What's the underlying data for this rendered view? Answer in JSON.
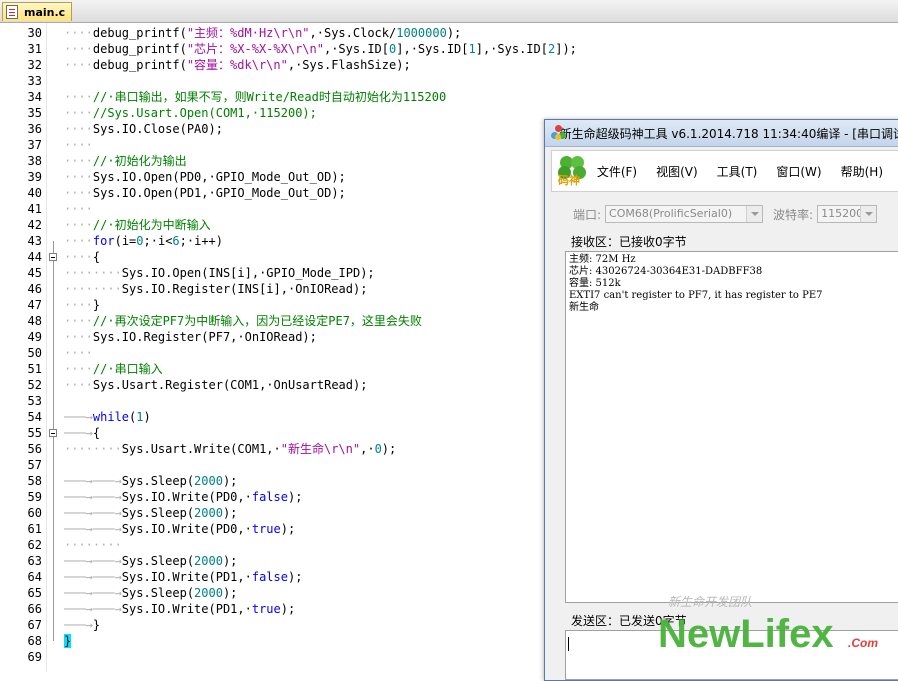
{
  "tab": {
    "name": "main.c"
  },
  "code_lines": [
    {
      "num": "30",
      "ws": "····",
      "parts": [
        [
          "",
          "debug_printf("
        ],
        [
          "str",
          "\"主频：%dM·Hz\\r\\n\""
        ],
        [
          "",
          ",·Sys.Clock/"
        ],
        [
          "numl",
          "1000000"
        ],
        [
          "",
          ");"
        ]
      ]
    },
    {
      "num": "31",
      "ws": "····",
      "parts": [
        [
          "",
          "debug_printf("
        ],
        [
          "str",
          "\"芯片：%X-%X-%X\\r\\n\""
        ],
        [
          "",
          ",·Sys.ID["
        ],
        [
          "numl",
          "0"
        ],
        [
          "",
          "],·Sys.ID["
        ],
        [
          "numl",
          "1"
        ],
        [
          "",
          "],·Sys.ID["
        ],
        [
          "numl",
          "2"
        ],
        [
          "",
          "]);"
        ]
      ]
    },
    {
      "num": "32",
      "ws": "····",
      "parts": [
        [
          "",
          "debug_printf("
        ],
        [
          "str",
          "\"容量：%dk\\r\\n\""
        ],
        [
          "",
          ",·Sys.FlashSize);"
        ]
      ]
    },
    {
      "num": "33",
      "ws": "",
      "parts": []
    },
    {
      "num": "34",
      "ws": "····",
      "parts": [
        [
          "cmt",
          "//·串口输出，如果不写，则Write/Read时自动初始化为115200"
        ]
      ]
    },
    {
      "num": "35",
      "ws": "····",
      "parts": [
        [
          "cmt",
          "//Sys.Usart.Open(COM1,·115200);"
        ]
      ]
    },
    {
      "num": "36",
      "ws": "····",
      "parts": [
        [
          "",
          "Sys.IO.Close(PA0);"
        ]
      ]
    },
    {
      "num": "37",
      "ws": "····",
      "parts": []
    },
    {
      "num": "38",
      "ws": "····",
      "parts": [
        [
          "cmt",
          "//·初始化为输出"
        ]
      ]
    },
    {
      "num": "39",
      "ws": "····",
      "parts": [
        [
          "",
          "Sys.IO.Open(PD0,·GPIO_Mode_Out_OD);"
        ]
      ]
    },
    {
      "num": "40",
      "ws": "····",
      "parts": [
        [
          "",
          "Sys.IO.Open(PD1,·GPIO_Mode_Out_OD);"
        ]
      ]
    },
    {
      "num": "41",
      "ws": "····",
      "parts": []
    },
    {
      "num": "42",
      "ws": "····",
      "parts": [
        [
          "cmt",
          "//·初始化为中断输入"
        ]
      ]
    },
    {
      "num": "43",
      "ws": "····",
      "parts": [
        [
          "kw",
          "for"
        ],
        [
          "",
          "(i="
        ],
        [
          "numl",
          "0"
        ],
        [
          "",
          ";·i<"
        ],
        [
          "numl",
          "6"
        ],
        [
          "",
          ";·i++)"
        ]
      ]
    },
    {
      "num": "44",
      "ws": "····",
      "parts": [
        [
          "",
          "{"
        ]
      ]
    },
    {
      "num": "45",
      "ws": "········",
      "parts": [
        [
          "",
          "Sys.IO.Open(INS[i],·GPIO_Mode_IPD);"
        ]
      ]
    },
    {
      "num": "46",
      "ws": "········",
      "parts": [
        [
          "",
          "Sys.IO.Register(INS[i],·OnIORead);"
        ]
      ]
    },
    {
      "num": "47",
      "ws": "····",
      "parts": [
        [
          "",
          "}"
        ]
      ]
    },
    {
      "num": "48",
      "ws": "····",
      "parts": [
        [
          "cmt",
          "//·再次设定PF7为中断输入，因为已经设定PE7，这里会失败"
        ]
      ]
    },
    {
      "num": "49",
      "ws": "····",
      "parts": [
        [
          "",
          "Sys.IO.Register(PF7,·OnIORead);"
        ]
      ]
    },
    {
      "num": "50",
      "ws": "····",
      "parts": []
    },
    {
      "num": "51",
      "ws": "····",
      "parts": [
        [
          "cmt",
          "//·串口输入"
        ]
      ]
    },
    {
      "num": "52",
      "ws": "····",
      "parts": [
        [
          "",
          "Sys.Usart.Register(COM1,·OnUsartRead);"
        ]
      ]
    },
    {
      "num": "53",
      "ws": "",
      "parts": []
    },
    {
      "num": "54",
      "ws": "───→",
      "parts": [
        [
          "kw",
          "while"
        ],
        [
          "",
          "("
        ],
        [
          "numl",
          "1"
        ],
        [
          "",
          ")"
        ]
      ]
    },
    {
      "num": "55",
      "ws": "───→",
      "parts": [
        [
          "",
          "{"
        ]
      ]
    },
    {
      "num": "56",
      "ws": "········",
      "parts": [
        [
          "",
          "Sys.Usart.Write(COM1,·"
        ],
        [
          "str",
          "\"新生命\\r\\n\""
        ],
        [
          "",
          ",·"
        ],
        [
          "numl",
          "0"
        ],
        [
          "",
          ");"
        ]
      ]
    },
    {
      "num": "57",
      "ws": "",
      "parts": []
    },
    {
      "num": "58",
      "ws": "───→───→",
      "parts": [
        [
          "",
          "Sys.Sleep("
        ],
        [
          "numl",
          "2000"
        ],
        [
          "",
          ");"
        ]
      ]
    },
    {
      "num": "59",
      "ws": "───→───→",
      "parts": [
        [
          "",
          "Sys.IO.Write(PD0,·"
        ],
        [
          "kw",
          "false"
        ],
        [
          "",
          ");"
        ]
      ]
    },
    {
      "num": "60",
      "ws": "───→───→",
      "parts": [
        [
          "",
          "Sys.Sleep("
        ],
        [
          "numl",
          "2000"
        ],
        [
          "",
          ");"
        ]
      ]
    },
    {
      "num": "61",
      "ws": "───→───→",
      "parts": [
        [
          "",
          "Sys.IO.Write(PD0,·"
        ],
        [
          "kw",
          "true"
        ],
        [
          "",
          ");"
        ]
      ]
    },
    {
      "num": "62",
      "ws": "········",
      "parts": []
    },
    {
      "num": "63",
      "ws": "───→───→",
      "parts": [
        [
          "",
          "Sys.Sleep("
        ],
        [
          "numl",
          "2000"
        ],
        [
          "",
          ");"
        ]
      ]
    },
    {
      "num": "64",
      "ws": "───→───→",
      "parts": [
        [
          "",
          "Sys.IO.Write(PD1,·"
        ],
        [
          "kw",
          "false"
        ],
        [
          "",
          ");"
        ]
      ]
    },
    {
      "num": "65",
      "ws": "───→───→",
      "parts": [
        [
          "",
          "Sys.Sleep("
        ],
        [
          "numl",
          "2000"
        ],
        [
          "",
          ");"
        ]
      ]
    },
    {
      "num": "66",
      "ws": "───→───→",
      "parts": [
        [
          "",
          "Sys.IO.Write(PD1,·"
        ],
        [
          "kw",
          "true"
        ],
        [
          "",
          ");"
        ]
      ]
    },
    {
      "num": "67",
      "ws": "───→",
      "parts": [
        [
          "",
          "}"
        ]
      ]
    },
    {
      "num": "68",
      "ws": "",
      "parts": [
        [
          "brace",
          "}"
        ]
      ]
    },
    {
      "num": "69",
      "ws": "",
      "parts": []
    }
  ],
  "tool": {
    "title": "新生命超级码神工具 v6.1.2014.718 11:34:40编译 - [串口调试",
    "logo_text": "码神",
    "menu": [
      "文件(F)",
      "视图(V)",
      "工具(T)",
      "窗口(W)",
      "帮助(H)"
    ],
    "port_label": "端口:",
    "port_value": "COM68(ProlificSerial0)",
    "baud_label": "波特率:",
    "baud_value": "115200",
    "recv_label": "接收区：已接收0字节",
    "recv_lines": [
      "主频: 72M Hz",
      "芯片: 43026724-30364E31-DADBFF38",
      "容量: 512k",
      "EXTI7 can't register to PF7, it has register to PE7",
      "新生命"
    ],
    "send_label": "发送区：已发送0字节"
  },
  "watermark": {
    "team": "新生命开发团队",
    "brand": "NewLifex",
    "suffix": ".Com"
  },
  "colors": {
    "string": "#a010a0",
    "comment": "#008000",
    "keyword": "#0000ff",
    "number": "#008080",
    "brand_green": "#48b23a"
  }
}
